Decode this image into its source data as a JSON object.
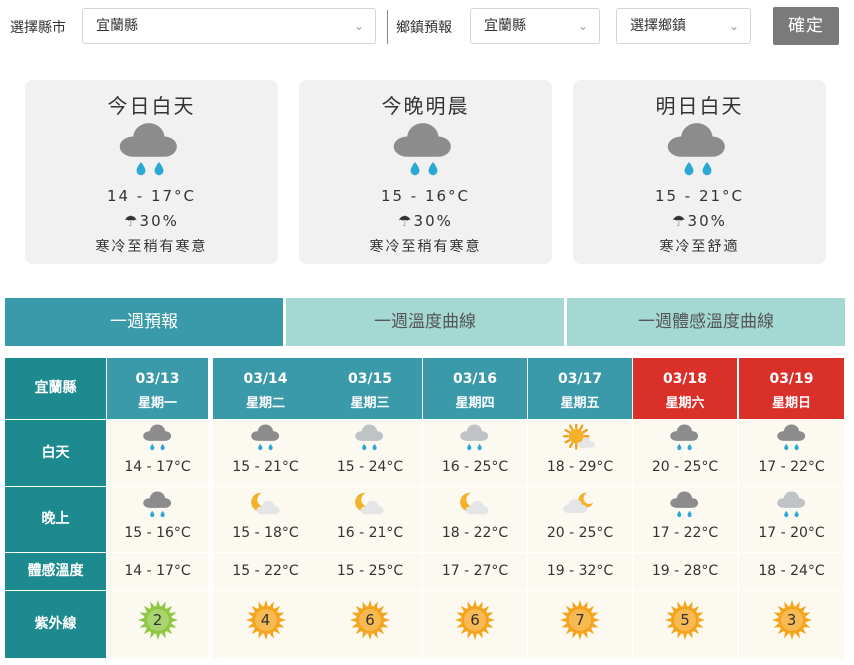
{
  "selectors": {
    "county_label": "選擇縣市",
    "county_value": "宜蘭縣",
    "town_label": "鄉鎮預報",
    "town_county_value": "宜蘭縣",
    "town_value": "選擇鄉鎮",
    "confirm_label": "確定"
  },
  "cards": [
    {
      "title": "今日白天",
      "icon": "rain-cloud-icon",
      "temp": "14 - 17°C",
      "rain": "30%",
      "feel": "寒冷至稍有寒意"
    },
    {
      "title": "今晚明晨",
      "icon": "rain-cloud-icon",
      "temp": "15 - 16°C",
      "rain": "30%",
      "feel": "寒冷至稍有寒意"
    },
    {
      "title": "明日白天",
      "icon": "rain-cloud-icon",
      "temp": "15 - 21°C",
      "rain": "30%",
      "feel": "寒冷至舒適"
    }
  ],
  "tabs": [
    {
      "label": "一週預報",
      "active": true
    },
    {
      "label": "一週溫度曲線",
      "active": false
    },
    {
      "label": "一週體感溫度曲線",
      "active": false
    }
  ],
  "week": {
    "county": "宜蘭縣",
    "row_labels": {
      "day": "白天",
      "night": "晚上",
      "feel": "體感溫度",
      "uv": "紫外線"
    },
    "colors": {
      "header": "#3a9aaa",
      "weekend": "#d9302a",
      "row_header": "#1c8a8f"
    },
    "days": [
      {
        "date": "03/13",
        "weekday": "星期一",
        "weekend": false,
        "day_icon": "rain-cloud-icon",
        "day_temp": "14 - 17°C",
        "night_icon": "rain-cloud-icon",
        "night_temp": "15 - 16°C",
        "feel": "14 - 17°C",
        "uv": "2",
        "uv_color": "#8dc63f"
      },
      {
        "date": "03/14",
        "weekday": "星期二",
        "weekend": false,
        "day_icon": "rain-cloud-icon",
        "day_temp": "15 - 21°C",
        "night_icon": "moon-cloud-icon",
        "night_temp": "15 - 18°C",
        "feel": "15 - 22°C",
        "uv": "4",
        "uv_color": "#f5a31a"
      },
      {
        "date": "03/15",
        "weekday": "星期三",
        "weekend": false,
        "day_icon": "light-rain-cloud-icon",
        "day_temp": "15 - 24°C",
        "night_icon": "moon-cloud-icon",
        "night_temp": "16 - 21°C",
        "feel": "15 - 25°C",
        "uv": "6",
        "uv_color": "#f5a31a"
      },
      {
        "date": "03/16",
        "weekday": "星期四",
        "weekend": false,
        "day_icon": "light-rain-cloud-icon",
        "day_temp": "16 - 25°C",
        "night_icon": "moon-cloud-icon",
        "night_temp": "18 - 22°C",
        "feel": "17 - 27°C",
        "uv": "6",
        "uv_color": "#f5a31a"
      },
      {
        "date": "03/17",
        "weekday": "星期五",
        "weekend": false,
        "day_icon": "sun-cloud-icon",
        "day_temp": "18 - 29°C",
        "night_icon": "cloud-moon-icon",
        "night_temp": "20 - 25°C",
        "feel": "19 - 32°C",
        "uv": "7",
        "uv_color": "#f5a31a"
      },
      {
        "date": "03/18",
        "weekday": "星期六",
        "weekend": true,
        "day_icon": "rain-cloud-icon",
        "day_temp": "20 - 25°C",
        "night_icon": "rain-cloud-icon",
        "night_temp": "17 - 22°C",
        "feel": "19 - 28°C",
        "uv": "5",
        "uv_color": "#f5a31a"
      },
      {
        "date": "03/19",
        "weekday": "星期日",
        "weekend": true,
        "day_icon": "rain-cloud-icon",
        "day_temp": "17 - 22°C",
        "night_icon": "light-rain-cloud-icon",
        "night_temp": "17 - 20°C",
        "feel": "18 - 24°C",
        "uv": "3",
        "uv_color": "#f5a31a"
      }
    ]
  }
}
